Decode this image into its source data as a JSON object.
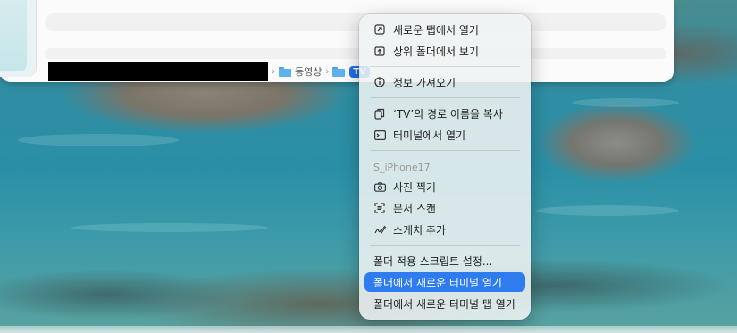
{
  "pathbar": {
    "crumbs": [
      {
        "label": "동영상",
        "icon": "folder-icon"
      },
      {
        "label": "TV",
        "icon": "folder-icon",
        "active": true
      }
    ],
    "separator": "›"
  },
  "menu": {
    "items": [
      {
        "label": "새로운 탭에서 열기",
        "icon": "open-tab-icon"
      },
      {
        "label": "상위 폴더에서 보기",
        "icon": "enclosing-folder-icon"
      },
      {
        "label": "정보 가져오기",
        "icon": "info-icon"
      },
      {
        "label": "‘TV’의 경로 이름을 복사",
        "icon": "copy-path-icon"
      },
      {
        "label": "터미널에서 열기",
        "icon": "terminal-icon"
      },
      {
        "label": "사진 찍기",
        "icon": "camera-icon"
      },
      {
        "label": "문서 스캔",
        "icon": "scan-icon"
      },
      {
        "label": "스케치 추가",
        "icon": "sketch-icon"
      },
      {
        "label": "폴더 적용 스크립트 설정..."
      },
      {
        "label": "폴더에서 새로운 터미널 열기",
        "highlighted": true
      },
      {
        "label": "폴더에서 새로운 터미널 탭 열기"
      }
    ],
    "section_header": "S_iPhone17",
    "highlight_color": "#2f7bf0"
  }
}
